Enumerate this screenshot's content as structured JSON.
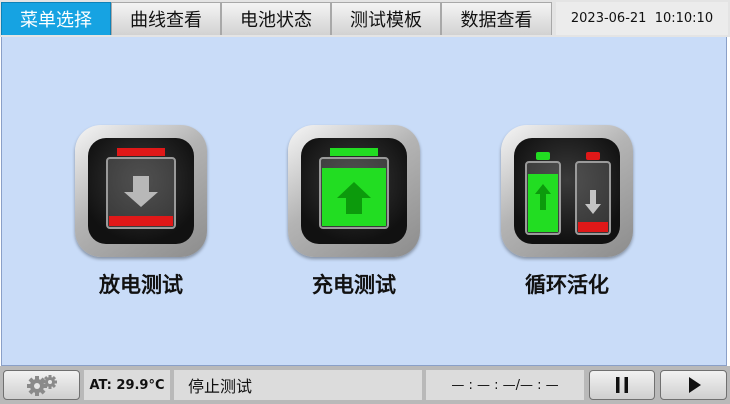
{
  "tabs": [
    {
      "label": "菜单选择",
      "active": true
    },
    {
      "label": "曲线查看",
      "active": false
    },
    {
      "label": "电池状态",
      "active": false
    },
    {
      "label": "测试模板",
      "active": false
    },
    {
      "label": "数据查看",
      "active": false
    }
  ],
  "datetime": "2023-06-21  10:10:10",
  "menu": {
    "discharge_label": "放电测试",
    "charge_label": "充电测试",
    "cycle_label": "循环活化"
  },
  "status": {
    "ambient_temp": "AT: 29.9°C",
    "state_text": "停止测试",
    "timer": "— : — : —/— : —"
  },
  "colors": {
    "active_tab": "#16a3e2",
    "main_bg": "#c9dcf8",
    "battery_red": "#e01818",
    "battery_green": "#22dd22"
  },
  "icons": {
    "settings": "gears-icon",
    "pause": "pause-icon",
    "play": "play-icon"
  }
}
